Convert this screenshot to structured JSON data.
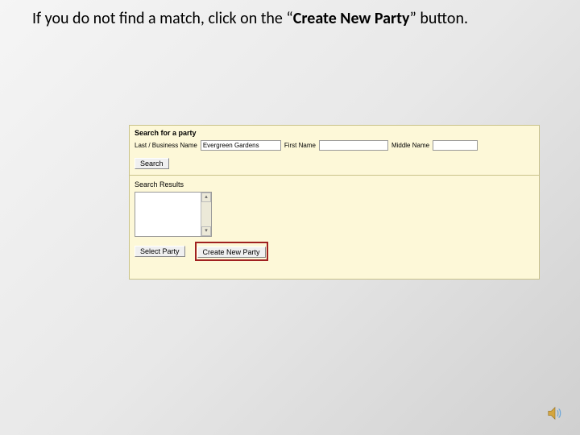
{
  "instruction": {
    "prefix": "If you do not find a match, click on the “",
    "bold": "Create New Party",
    "suffix": "” button."
  },
  "panel": {
    "search_title": "Search for a party",
    "labels": {
      "last_business": "Last / Business Name",
      "first": "First Name",
      "middle": "Middle Name"
    },
    "values": {
      "last_business": "Evergreen Gardens",
      "first": "",
      "middle": ""
    },
    "buttons": {
      "search": "Search",
      "select_party": "Select Party",
      "create_new_party": "Create New Party"
    },
    "results_title": "Search Results"
  }
}
